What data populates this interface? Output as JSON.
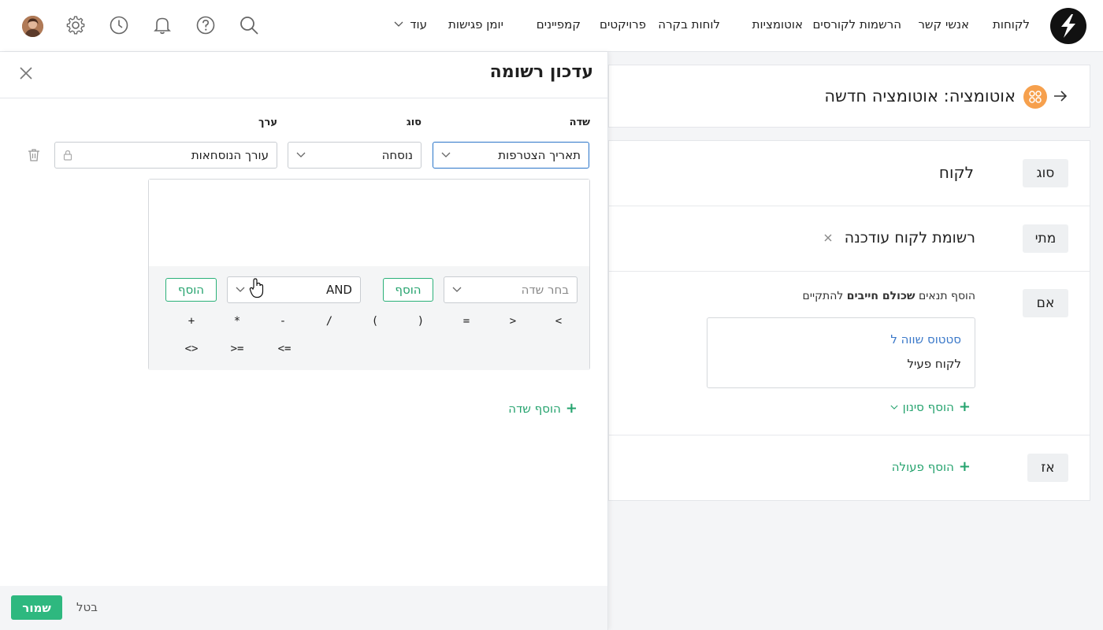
{
  "nav": {
    "items": [
      "לקוחות",
      "אנשי קשר",
      "הרשמות לקורסים",
      "אוטומציות",
      "לוחות בקרה",
      "פרויקטים",
      "קמפיינים",
      "יומן פגישות"
    ],
    "more": "עוד"
  },
  "icons": {
    "search": "search-icon",
    "help": "help-icon",
    "notifications": "bell-icon",
    "history": "clock-icon",
    "settings": "gear-icon"
  },
  "page": {
    "title": "אוטומציה: אוטומציה חדשה",
    "type_label": "סוג",
    "type_value": "לקוח",
    "when_label": "מתי",
    "when_value": "רשומת לקוח עודכנה",
    "if_label": "אם",
    "if_intro_before": "הוסף תנאים ",
    "if_intro_bold": "שכולם חייבים",
    "if_intro_after": " להתקיים",
    "condition_field": "סטטוס שווה ל",
    "condition_value": "לקוח פעיל",
    "add_filter": "הוסף סינון",
    "then_label": "אז",
    "add_action": "הוסף פעולה"
  },
  "drawer": {
    "title": "עדכון רשומה",
    "col_field": "שדה",
    "col_type": "סוג",
    "col_value": "ערך",
    "field_value": "תאריך הצטרפות",
    "type_value": "נוסחה",
    "value_value": "עורך הנוסחאות",
    "field_picker_placeholder": "בחר שדה",
    "add_label": "הוסף",
    "logic_value": "AND",
    "operators_row1": [
      ">",
      "<",
      "=",
      "(",
      ")",
      "/",
      "-",
      "*",
      "+"
    ],
    "operators_row2": [
      "=>",
      "=<",
      "<>"
    ],
    "add_field": "הוסף שדה",
    "save": "שמור",
    "cancel": "בטל"
  },
  "colors": {
    "accent_green": "#2eb87f",
    "link_blue": "#3a78c9",
    "automation_orange": "#f6a04d"
  }
}
